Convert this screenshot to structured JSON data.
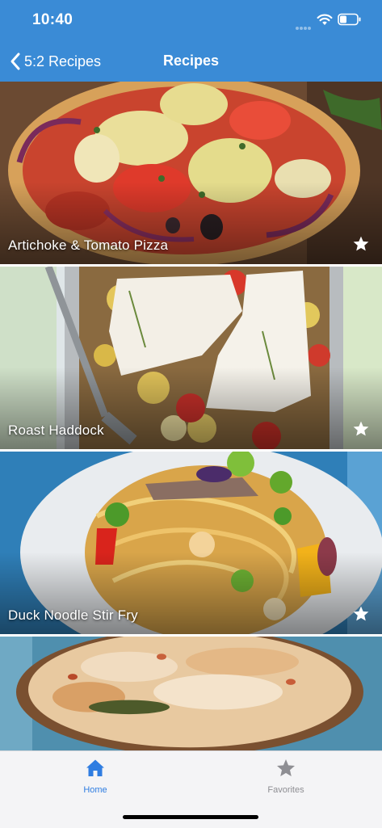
{
  "status_bar": {
    "time": "10:40",
    "icons": [
      "signal-dots-icon",
      "wifi-icon",
      "battery-icon"
    ]
  },
  "nav": {
    "back_label": "5:2 Recipes",
    "title": "Recipes"
  },
  "recipes": [
    {
      "title": "Artichoke & Tomato Pizza",
      "favorite_icon": "star-icon"
    },
    {
      "title": "Roast Haddock",
      "favorite_icon": "star-icon"
    },
    {
      "title": "Duck Noodle Stir Fry",
      "favorite_icon": "star-icon"
    },
    {
      "title": "",
      "favorite_icon": ""
    }
  ],
  "tabs": [
    {
      "label": "Home",
      "icon": "house-icon",
      "selected": true
    },
    {
      "label": "Favorites",
      "icon": "star-icon",
      "selected": false
    }
  ],
  "colors": {
    "header_bg": "#3a8bd6",
    "tab_selected": "#2f7de1",
    "tab_unselected": "#8e8e93"
  }
}
